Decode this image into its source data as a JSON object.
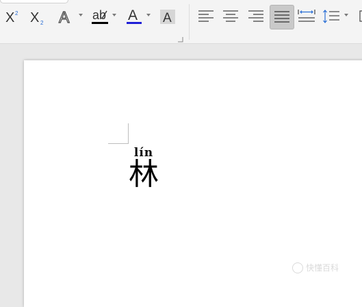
{
  "toolbar": {
    "superscript": {
      "icon": "superscript-icon",
      "label": "X",
      "sup": "2"
    },
    "subscript": {
      "icon": "subscript-icon",
      "label": "X",
      "sub": "2"
    },
    "text_effect": {
      "icon": "text-effect-icon",
      "label": "A"
    },
    "highlight": {
      "icon": "highlight-icon",
      "label": "ab",
      "color": "#000000"
    },
    "font_color": {
      "icon": "font-color-icon",
      "label": "A",
      "color": "#1f1fd6"
    },
    "char_shading": {
      "icon": "character-shading-icon",
      "label": "A"
    },
    "align_left": {
      "icon": "align-left-icon"
    },
    "align_center": {
      "icon": "align-center-icon"
    },
    "align_right": {
      "icon": "align-right-icon"
    },
    "justify": {
      "icon": "justify-icon",
      "active": true
    },
    "distributed": {
      "icon": "distributed-align-icon"
    },
    "line_spacing": {
      "icon": "line-spacing-icon"
    }
  },
  "document": {
    "pinyin": "lín",
    "character": "林"
  },
  "watermark": {
    "text": "快懂百科"
  }
}
